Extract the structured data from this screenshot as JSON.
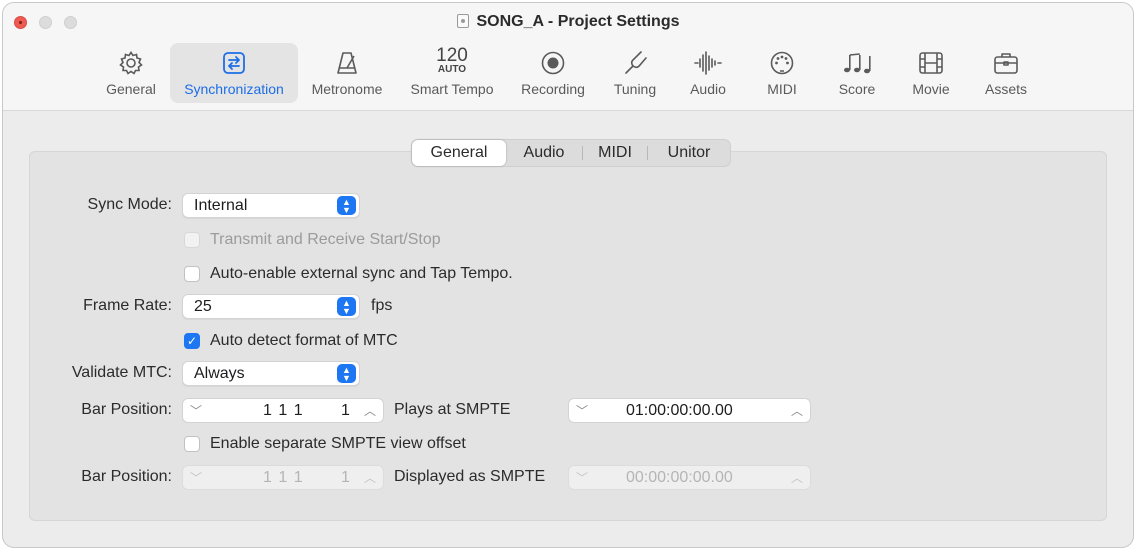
{
  "window": {
    "title": "SONG_A - Project Settings",
    "accent_color": "#1d76f2"
  },
  "toolbar": {
    "items": [
      {
        "label": "General",
        "icon": "gear-icon"
      },
      {
        "label": "Synchronization",
        "icon": "sync-arrows-icon",
        "active": true
      },
      {
        "label": "Metronome",
        "icon": "metronome-icon"
      },
      {
        "label": "Smart Tempo",
        "icon": "tempo-icon",
        "tempo_value": "120",
        "tempo_mode": "AUTO"
      },
      {
        "label": "Recording",
        "icon": "record-icon"
      },
      {
        "label": "Tuning",
        "icon": "tuning-fork-icon"
      },
      {
        "label": "Audio",
        "icon": "waveform-icon"
      },
      {
        "label": "MIDI",
        "icon": "midi-connector-icon"
      },
      {
        "label": "Score",
        "icon": "music-notes-icon"
      },
      {
        "label": "Movie",
        "icon": "film-icon"
      },
      {
        "label": "Assets",
        "icon": "briefcase-icon"
      }
    ]
  },
  "tabs": [
    {
      "label": "General",
      "active": true
    },
    {
      "label": "Audio"
    },
    {
      "label": "MIDI"
    },
    {
      "label": "Unitor"
    }
  ],
  "form": {
    "sync_mode": {
      "label": "Sync Mode:",
      "value": "Internal"
    },
    "transmit_receive": {
      "label": "Transmit and Receive Start/Stop",
      "checked": false,
      "disabled": true
    },
    "auto_enable_sync": {
      "label": "Auto-enable external sync and Tap Tempo.",
      "checked": false
    },
    "frame_rate": {
      "label": "Frame Rate:",
      "value": "25",
      "unit": "fps"
    },
    "auto_detect_mtc": {
      "label": "Auto detect format of MTC",
      "checked": true
    },
    "validate_mtc": {
      "label": "Validate MTC:",
      "value": "Always"
    },
    "bar_position_1": {
      "label": "Bar Position:",
      "value_main": "1 1 1",
      "value_tick": "1",
      "smpte_label": "Plays at SMPTE",
      "smpte_value": "01:00:00:00.00"
    },
    "separate_smpte_offset": {
      "label": "Enable separate SMPTE view offset",
      "checked": false
    },
    "bar_position_2": {
      "label": "Bar Position:",
      "value_main": "1 1 1",
      "value_tick": "1",
      "smpte_label": "Displayed as SMPTE",
      "smpte_value": "00:00:00:00.00",
      "disabled": true
    }
  }
}
